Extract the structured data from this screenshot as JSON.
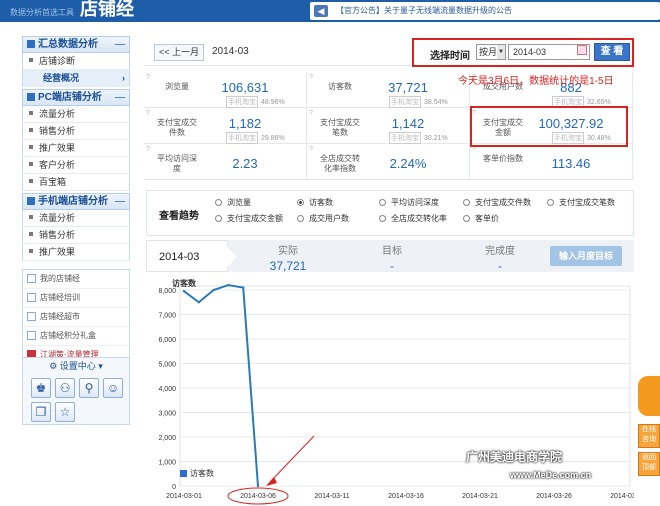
{
  "header": {
    "logo_small": "数据分析首选工具",
    "logo": "店铺经",
    "notice": "【官方公告】关于量子无线端流量数据升级的公告"
  },
  "sidebar": {
    "sections": [
      {
        "title": "汇总数据分析",
        "items": [
          "店铺诊断",
          "经营概况"
        ],
        "active": 1
      },
      {
        "title": "PC端店铺分析",
        "items": [
          "流量分析",
          "销售分析",
          "推广效果",
          "客户分析",
          "百宝箱"
        ],
        "active": -1
      },
      {
        "title": "手机端店铺分析",
        "items": [
          "流量分析",
          "销售分析",
          "推广效果"
        ],
        "active": -1
      }
    ],
    "tools": [
      "我的店铺经",
      "店铺经培训",
      "店铺经超市",
      "店铺经积分礼盒",
      "江湖策-流量管理"
    ],
    "settings_title": "设置中心",
    "toggle": "—"
  },
  "filter": {
    "prev_label": "<< 上一月",
    "current_month": "2014-03",
    "select_label": "选择时间",
    "period_value": "按月",
    "date_value": "2014-03",
    "view_label": "查 看"
  },
  "note": "今天是3月6日，数据统计的是1-5日",
  "metrics": [
    [
      {
        "label": "浏览量",
        "value": "106,631",
        "tag": "手机淘宝",
        "pct": "48.96%"
      },
      {
        "label": "访客数",
        "value": "37,721",
        "tag": "手机淘宝",
        "pct": "38.54%"
      },
      {
        "label": "成交用户数",
        "value": "882",
        "tag": "手机淘宝",
        "pct": "32.65%"
      }
    ],
    [
      {
        "label": "支付宝成交件数",
        "value": "1,182",
        "tag": "手机淘宝",
        "pct": "29.86%"
      },
      {
        "label": "支付宝成交笔数",
        "value": "1,142",
        "tag": "手机淘宝",
        "pct": "30.21%"
      },
      {
        "label": "支付宝成交金额",
        "value": "100,327.92",
        "tag": "手机淘宝",
        "pct": "30.48%"
      }
    ],
    [
      {
        "label": "平均访问深度",
        "value": "2.23"
      },
      {
        "label": "全店成交转化率指数",
        "value": "2.24%"
      },
      {
        "label": "客单价指数",
        "value": "113.46"
      }
    ]
  ],
  "trend": {
    "label": "查看趋势",
    "options": [
      {
        "label": "浏览量",
        "on": false
      },
      {
        "label": "访客数",
        "on": true
      },
      {
        "label": "平均访问深度",
        "on": false
      },
      {
        "label": "支付宝成交件数",
        "on": false
      },
      {
        "label": "支付宝成交笔数",
        "on": false
      },
      {
        "label": "支付宝成交金额",
        "on": false
      },
      {
        "label": "成交用户数",
        "on": false
      },
      {
        "label": "全店成交转化率",
        "on": false
      },
      {
        "label": "客单价",
        "on": false
      }
    ]
  },
  "summary": {
    "month": "2014-03",
    "actual_label": "实际",
    "actual_value": "37,721",
    "target_label": "目标",
    "target_value": "-",
    "completion_label": "完成度",
    "completion_value": "-",
    "target_button": "输入月度目标"
  },
  "chart_data": {
    "type": "line",
    "ylabel": "访客数",
    "legend": "访客数",
    "ylim": [
      0,
      8000
    ],
    "yticks": [
      "0",
      "1,000",
      "2,000",
      "3,000",
      "4,000",
      "5,000",
      "6,000",
      "7,000",
      "8,000"
    ],
    "xticks": [
      "2014-03-01",
      "2014-03-06",
      "2014-03-11",
      "2014-03-16",
      "2014-03-21",
      "2014-03-26",
      "2014-03-31"
    ],
    "x_days": [
      1,
      2,
      3,
      4,
      5,
      6
    ],
    "values": [
      7950,
      7500,
      8000,
      8200,
      8100,
      0
    ]
  },
  "watermark": "广州美迪电商学院",
  "watermark_url": "www.MeDe.com.cn",
  "mascot": {
    "btn1": "在线咨询",
    "btn2": "返回顶部"
  },
  "colors": {
    "accent": "#2368b8",
    "highlight": "#d9231f",
    "series": "#2a7ab8"
  }
}
